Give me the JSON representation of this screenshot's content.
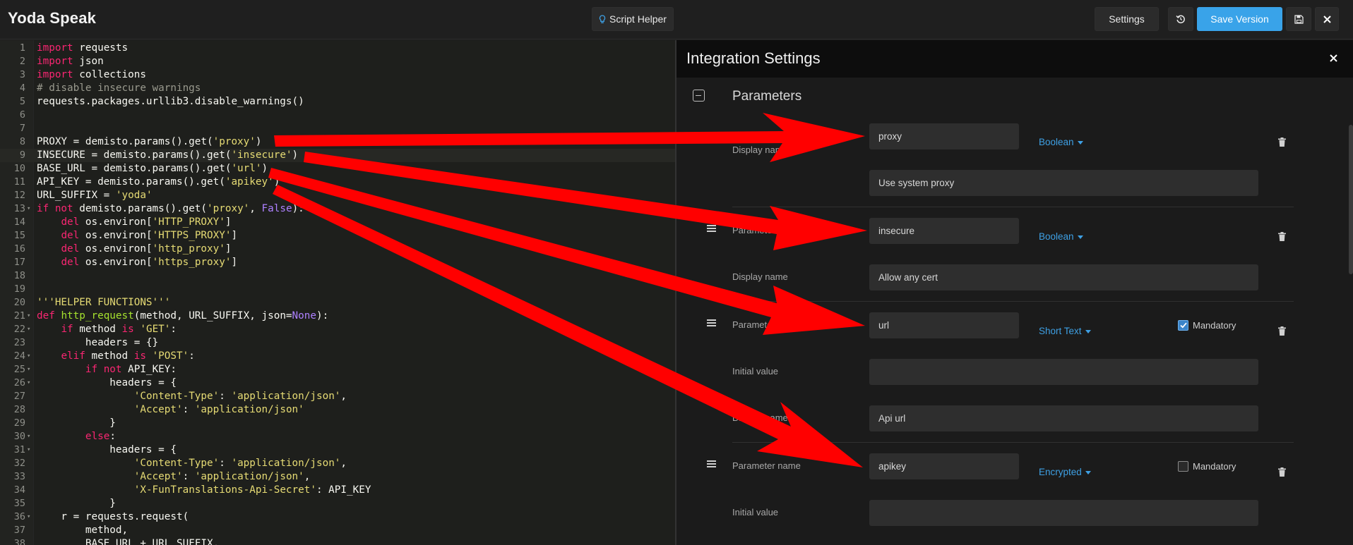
{
  "header": {
    "title": "Yoda Speak",
    "script_helper_label": "Script Helper",
    "settings_label": "Settings",
    "save_version_label": "Save Version"
  },
  "editor": {
    "lines": [
      {
        "n": "1",
        "fold": "",
        "html": "<span class='kw'>import</span> requests"
      },
      {
        "n": "2",
        "fold": "",
        "html": "<span class='kw'>import</span> json"
      },
      {
        "n": "3",
        "fold": "",
        "html": "<span class='kw'>import</span> collections"
      },
      {
        "n": "4",
        "fold": "",
        "html": "<span class='cm'># disable insecure warnings</span>"
      },
      {
        "n": "5",
        "fold": "",
        "html": "requests.packages.urllib3.disable_warnings()"
      },
      {
        "n": "6",
        "fold": "",
        "html": ""
      },
      {
        "n": "7",
        "fold": "",
        "html": ""
      },
      {
        "n": "8",
        "fold": "",
        "html": "PROXY = demisto.params().get(<span class='st'>'proxy'</span>)"
      },
      {
        "n": "9",
        "fold": "",
        "html": "INSECURE = demisto.params().get(<span class='st'>'insecure'</span>)",
        "active": true
      },
      {
        "n": "10",
        "fold": "",
        "html": "BASE_URL = demisto.params().get(<span class='st'>'url'</span>)"
      },
      {
        "n": "11",
        "fold": "",
        "html": "API_KEY = demisto.params().get(<span class='st'>'apikey'</span>)"
      },
      {
        "n": "12",
        "fold": "",
        "html": "URL_SUFFIX = <span class='st'>'yoda'</span>"
      },
      {
        "n": "13",
        "fold": "-",
        "html": "<span class='kw'>if not</span> demisto.params().get(<span class='st'>'proxy'</span>, <span class='nm'>False</span>):"
      },
      {
        "n": "14",
        "fold": "",
        "html": "    <span class='kw'>del</span> os.environ[<span class='st'>'HTTP_PROXY'</span>]"
      },
      {
        "n": "15",
        "fold": "",
        "html": "    <span class='kw'>del</span> os.environ[<span class='st'>'HTTPS_PROXY'</span>]"
      },
      {
        "n": "16",
        "fold": "",
        "html": "    <span class='kw'>del</span> os.environ[<span class='st'>'http_proxy'</span>]"
      },
      {
        "n": "17",
        "fold": "",
        "html": "    <span class='kw'>del</span> os.environ[<span class='st'>'https_proxy'</span>]"
      },
      {
        "n": "18",
        "fold": "",
        "html": ""
      },
      {
        "n": "19",
        "fold": "",
        "html": ""
      },
      {
        "n": "20",
        "fold": "",
        "html": "<span class='st'>'''HELPER FUNCTIONS'''</span>"
      },
      {
        "n": "21",
        "fold": "-",
        "html": "<span class='kw'>def</span> <span class='fn'>http_request</span>(method, URL_SUFFIX, json=<span class='nm'>None</span>):"
      },
      {
        "n": "22",
        "fold": "-",
        "html": "    <span class='kw'>if</span> method <span class='kw'>is</span> <span class='st'>'GET'</span>:"
      },
      {
        "n": "23",
        "fold": "",
        "html": "        headers = {}"
      },
      {
        "n": "24",
        "fold": "-",
        "html": "    <span class='kw'>elif</span> method <span class='kw'>is</span> <span class='st'>'POST'</span>:"
      },
      {
        "n": "25",
        "fold": "-",
        "html": "        <span class='kw'>if not</span> API_KEY:"
      },
      {
        "n": "26",
        "fold": "-",
        "html": "            headers = {"
      },
      {
        "n": "27",
        "fold": "",
        "html": "                <span class='st'>'Content-Type'</span>: <span class='st'>'application/json'</span>,"
      },
      {
        "n": "28",
        "fold": "",
        "html": "                <span class='st'>'Accept'</span>: <span class='st'>'application/json'</span>"
      },
      {
        "n": "29",
        "fold": "",
        "html": "            }"
      },
      {
        "n": "30",
        "fold": "-",
        "html": "        <span class='kw'>else</span>:"
      },
      {
        "n": "31",
        "fold": "-",
        "html": "            headers = {"
      },
      {
        "n": "32",
        "fold": "",
        "html": "                <span class='st'>'Content-Type'</span>: <span class='st'>'application/json'</span>,"
      },
      {
        "n": "33",
        "fold": "",
        "html": "                <span class='st'>'Accept'</span>: <span class='st'>'application/json'</span>,"
      },
      {
        "n": "34",
        "fold": "",
        "html": "                <span class='st'>'X-FunTranslations-Api-Secret'</span>: API_KEY"
      },
      {
        "n": "35",
        "fold": "",
        "html": "            }"
      },
      {
        "n": "36",
        "fold": "-",
        "html": "    r = requests.request("
      },
      {
        "n": "37",
        "fold": "",
        "html": "        method,"
      },
      {
        "n": "38",
        "fold": "",
        "html": "        BASE_URL + URL_SUFFIX,"
      }
    ]
  },
  "panel": {
    "title": "Integration Settings",
    "section_title": "Parameters",
    "labels": {
      "parameter_name": "Parameter name",
      "display_name": "Display name",
      "initial_value": "Initial value",
      "mandatory": "Mandatory"
    },
    "params": [
      {
        "name": "proxy",
        "type": "Boolean",
        "display": "Use system proxy"
      },
      {
        "name": "insecure",
        "type": "Boolean",
        "display": "Allow any cert"
      },
      {
        "name": "url",
        "type": "Short Text",
        "mandatory": true,
        "initial": "",
        "display": "Api url"
      },
      {
        "name": "apikey",
        "type": "Encrypted",
        "mandatory": false,
        "initial": ""
      }
    ]
  },
  "colors": {
    "accent": "#39a3e9",
    "arrow": "#ff0000"
  }
}
